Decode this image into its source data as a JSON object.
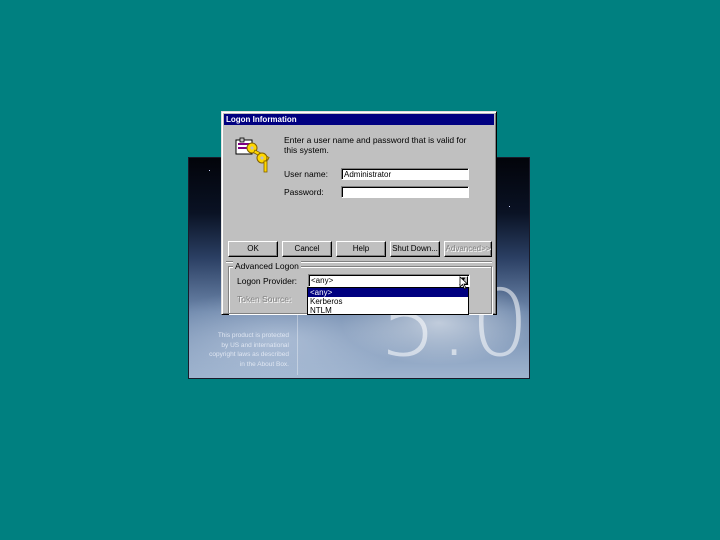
{
  "splash": {
    "version": "5.0",
    "copyright_lines": [
      "This product is protected",
      "by US and international",
      "copyright laws as described",
      "in the About Box."
    ]
  },
  "dialog": {
    "title": "Logon Information",
    "prompt": "Enter a user name and password that is valid for this system.",
    "username_label": "User name:",
    "username_value": "Administrator",
    "password_label": "Password:",
    "password_value": ""
  },
  "buttons": {
    "ok": "OK",
    "cancel": "Cancel",
    "help": "Help",
    "shutdown": "Shut Down...",
    "advanced": "Advanced>>"
  },
  "advanced": {
    "group_label": "Advanced Logon",
    "provider_label": "Logon Provider:",
    "provider_value": "<any>",
    "token_label": "Token Source:",
    "options": [
      "<any>",
      "Kerberos",
      "NTLM"
    ]
  },
  "colors": {
    "desktop": "#008080",
    "titlebar": "#000080",
    "face": "#c0c0c0"
  },
  "icons": {
    "key": "key-icon",
    "arrow": "chevron-down-icon",
    "cursor": "mouse-pointer-icon"
  }
}
